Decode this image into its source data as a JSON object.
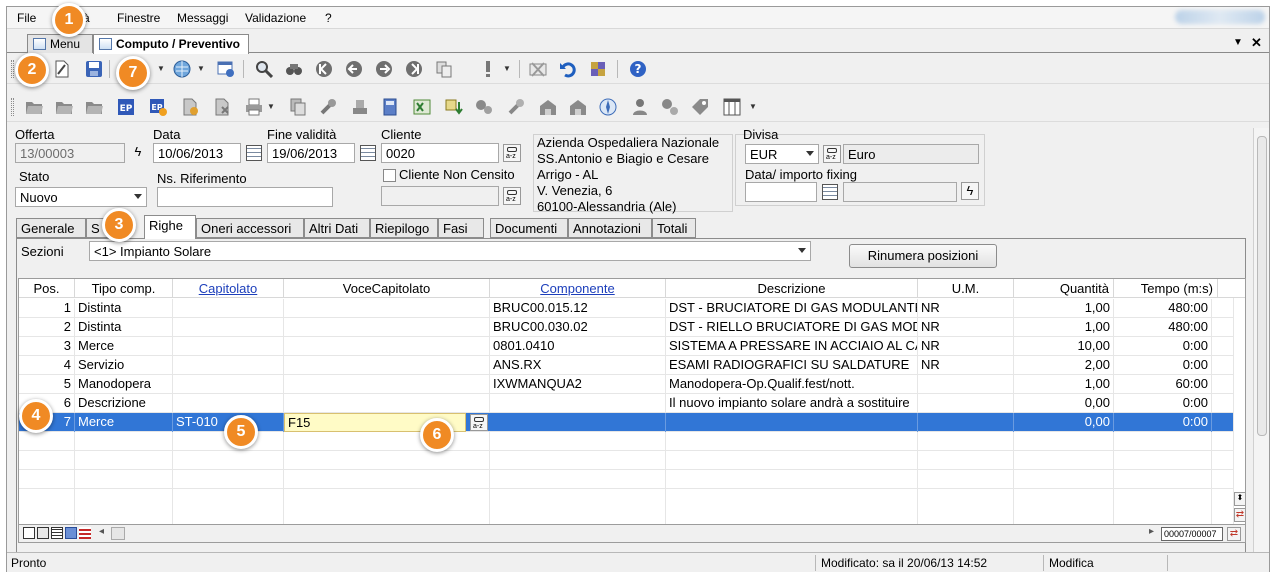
{
  "menu": [
    "File",
    "à",
    "Finestre",
    "Messaggi",
    "Validazione",
    "?"
  ],
  "tabs": {
    "menu_tab": "Menu",
    "doc_tab": "Computo / Preventivo"
  },
  "header": {
    "offerta_label": "Offerta",
    "offerta_value": "13/00003",
    "data_label": "Data",
    "data_value": "10/06/2013",
    "fine_label": "Fine validità",
    "fine_value": "19/06/2013",
    "cliente_label": "Cliente",
    "cliente_value": "0020",
    "cliente_non_censito": "Cliente Non Censito",
    "stato_label": "Stato",
    "stato_value": "Nuovo",
    "ns_rif_label": "Ns. Riferimento",
    "ns_rif_value": "",
    "address": [
      "Azienda Ospedaliera Nazionale",
      "SS.Antonio e Biagio e Cesare",
      "Arrigo - AL",
      "V. Venezia, 6",
      "60100-Alessandria (Ale)"
    ],
    "divisa_label": "Divisa",
    "divisa_value": "EUR",
    "divisa_desc": "Euro",
    "fixing_label": "Data/ importo fixing"
  },
  "subtabs": [
    "Generale",
    "S",
    "Righe",
    "Oneri accessori",
    "Altri Dati",
    "Riepilogo",
    "Fasi",
    "Documenti",
    "Annotazioni",
    "Totali"
  ],
  "sezioni": {
    "label": "Sezioni",
    "value": "<1> Impianto Solare",
    "rinumera": "Rinumera posizioni"
  },
  "grid": {
    "columns": [
      "Pos.",
      "Tipo comp.",
      "Capitolato",
      "VoceCapitolato",
      "Componente",
      "Descrizione",
      "U.M.",
      "Quantità",
      "Tempo (m:s)"
    ],
    "rows": [
      {
        "pos": "1",
        "tipo": "Distinta",
        "cap": "",
        "voce": "",
        "comp": "BRUC00.015.12",
        "desc": "DST - BRUCIATORE DI GAS MODULANTE",
        "um": "NR",
        "qta": "1,00",
        "tempo": "480:00"
      },
      {
        "pos": "2",
        "tipo": "Distinta",
        "cap": "",
        "voce": "",
        "comp": "BRUC00.030.02",
        "desc": "DST - RIELLO BRUCIATORE DI GAS MODULANTE",
        "um": "NR",
        "qta": "1,00",
        "tempo": "480:00"
      },
      {
        "pos": "3",
        "tipo": "Merce",
        "cap": "",
        "voce": "",
        "comp": "0801.0410",
        "desc": "SISTEMA A PRESSARE IN ACCIAIO AL CARBONIO",
        "um": "NR",
        "qta": "10,00",
        "tempo": "0:00"
      },
      {
        "pos": "4",
        "tipo": "Servizio",
        "cap": "",
        "voce": "",
        "comp": "ANS.RX",
        "desc": "ESAMI RADIOGRAFICI SU SALDATURE",
        "um": "NR",
        "qta": "2,00",
        "tempo": "0:00"
      },
      {
        "pos": "5",
        "tipo": "Manodopera",
        "cap": "",
        "voce": "",
        "comp": "IXWMANQUA2",
        "desc": "Manodopera-Op.Qualif.fest/nott.",
        "um": "",
        "qta": "1,00",
        "tempo": "60:00"
      },
      {
        "pos": "6",
        "tipo": "Descrizione",
        "cap": "",
        "voce": "",
        "comp": "",
        "desc": "Il nuovo impianto solare andrà a sostituire",
        "um": "",
        "qta": "0,00",
        "tempo": "0:00"
      },
      {
        "pos": "7",
        "tipo": "Merce",
        "cap": "ST-010",
        "voce": "F15",
        "comp": "",
        "desc": "",
        "um": "",
        "qta": "0,00",
        "tempo": "0:00"
      }
    ],
    "record_counter": "00007/00007"
  },
  "status": {
    "left": "Pronto",
    "modified": "Modificato: sa il 20/06/13 14:52",
    "mode": "Modifica"
  },
  "callouts": [
    "1",
    "2",
    "3",
    "4",
    "5",
    "6",
    "7"
  ]
}
